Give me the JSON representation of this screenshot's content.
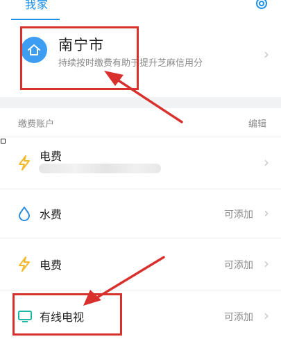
{
  "tabs": {
    "my_home": "我家"
  },
  "home": {
    "city": "南宁市",
    "subtitle": "持续按时缴费有助于提升芝麻信用分"
  },
  "accounts": {
    "section_title": "缴费账户",
    "edit_label": "编辑",
    "items": [
      {
        "title": "电费",
        "icon": "lightning-icon",
        "action": ""
      },
      {
        "title": "水费",
        "icon": "water-drop-icon",
        "action": "可添加"
      },
      {
        "title": "电费",
        "icon": "lightning-icon",
        "action": "可添加"
      },
      {
        "title": "有线电视",
        "icon": "tv-icon",
        "action": "可添加"
      }
    ]
  },
  "colors": {
    "accent": "#1b8fe6",
    "icon_blue": "#3d9df2",
    "lightning": "#f4b82a",
    "water": "#2a8de0",
    "tv": "#1fb7a9",
    "highlight": "#d7302d"
  }
}
